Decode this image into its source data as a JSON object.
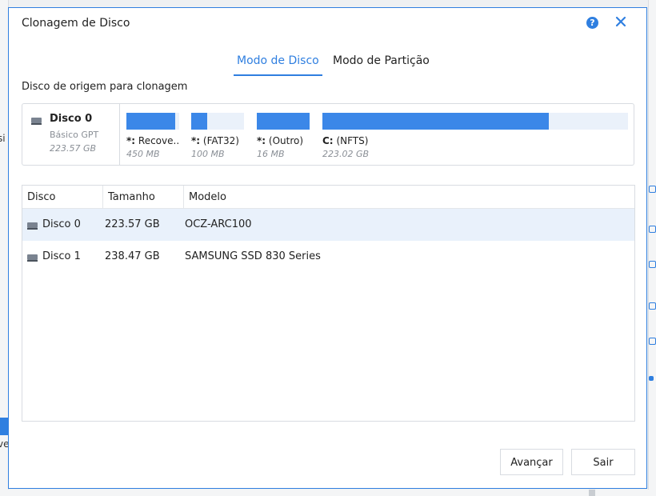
{
  "background": {
    "left_fragment_1": "si",
    "left_fragment_2": "ve"
  },
  "dialog": {
    "title": "Clonagem de Disco",
    "help_icon": "question-icon",
    "help_glyph": "?",
    "close_icon": "close-icon"
  },
  "tabs": [
    {
      "label": "Modo de Disco",
      "active": true
    },
    {
      "label": "Modo de Partição",
      "active": false
    }
  ],
  "source": {
    "label": "Disco de origem para clonagem",
    "disk": {
      "name": "Disco 0",
      "type": "Básico GPT",
      "size": "223.57 GB"
    },
    "partitions": [
      {
        "letter": "*:",
        "name": "Recove...",
        "size": "450 MB",
        "fill": 0.93
      },
      {
        "letter": "*:",
        "name": "(FAT32)",
        "size": "100 MB",
        "fill": 0.3
      },
      {
        "letter": "*:",
        "name": "(Outro)",
        "size": "16 MB",
        "fill": 1.0
      },
      {
        "letter": "C:",
        "name": "(NFTS)",
        "size": "223.02 GB",
        "fill": 0.74
      }
    ]
  },
  "table": {
    "columns": [
      "Disco",
      "Tamanho",
      "Modelo"
    ],
    "rows": [
      {
        "disk": "Disco 0",
        "size": "223.57 GB",
        "model": "OCZ-ARC100",
        "selected": true
      },
      {
        "disk": "Disco 1",
        "size": "238.47 GB",
        "model": "SAMSUNG SSD 830 Series",
        "selected": false
      }
    ]
  },
  "buttons": {
    "next": "Avançar",
    "exit": "Sair"
  },
  "colors": {
    "accent": "#2f7fe0",
    "partition_fill": "#3b87e8",
    "partition_empty": "#eaf1fa",
    "selected_row": "#e9f1fb"
  }
}
